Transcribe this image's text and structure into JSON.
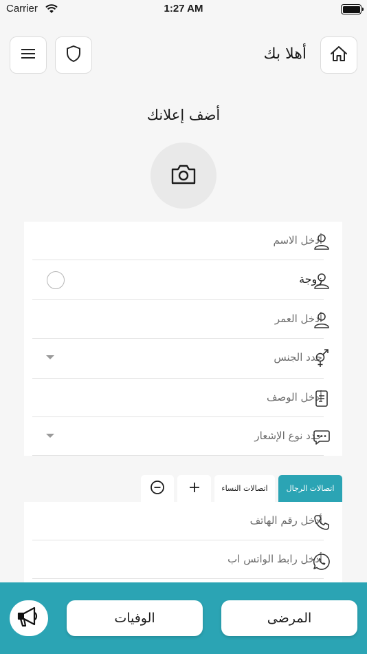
{
  "status_bar": {
    "carrier": "Carrier",
    "time": "1:27 AM"
  },
  "header": {
    "greeting": "أهلا بك",
    "icons": {
      "home": "home-icon",
      "shield": "shield-icon",
      "menu": "menu-icon"
    }
  },
  "page_title": "أضف إعلانك",
  "form": {
    "name_placeholder": "أدخل الاسم",
    "relation_value": "زوجة",
    "age_placeholder": "أدخل العمر",
    "gender_placeholder": "حدد الجنس",
    "description_placeholder": "أدخل الوصف",
    "notification_type_placeholder": "حدد نوع الإشعار"
  },
  "contacts": {
    "tabs": {
      "men": "اتصالات الرجال",
      "women": "اتصالات النساء"
    },
    "phone_placeholder": "أدخل رقم الهاتف",
    "whatsapp_placeholder": "أدخل رابط الواتس اب"
  },
  "bottom_nav": {
    "patients": "المرضى",
    "deaths": "الوفيات"
  },
  "colors": {
    "accent": "#2ba4b4",
    "background": "#f6f6f6"
  }
}
